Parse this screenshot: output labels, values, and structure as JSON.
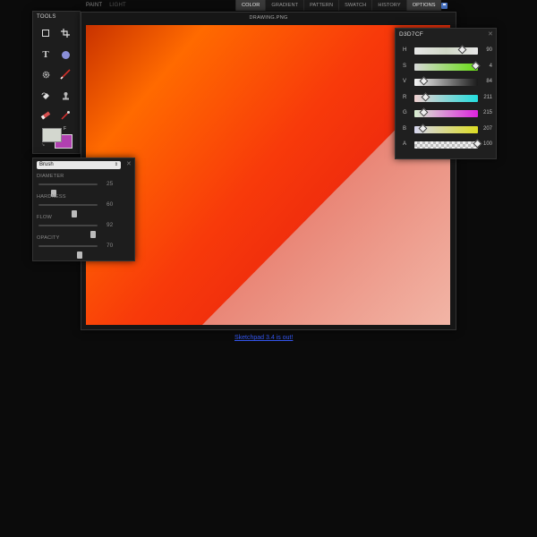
{
  "menu": {
    "left": [
      "PAINT",
      "LIGHT"
    ],
    "tabs": [
      "COLOR",
      "GRADIENT",
      "PATTERN",
      "SWATCH",
      "HISTORY",
      "OPTIONS"
    ],
    "active_tab": "COLOR"
  },
  "tools": {
    "title": "TOOLS",
    "items": [
      {
        "name": "select-tool",
        "glyph": "□"
      },
      {
        "name": "crop-tool",
        "glyph": "⌗"
      },
      {
        "name": "text-tool",
        "glyph": "T"
      },
      {
        "name": "shape-tool",
        "glyph": "●"
      },
      {
        "name": "gear-tool",
        "glyph": "✲"
      },
      {
        "name": "brush-tool",
        "glyph": "╱"
      },
      {
        "name": "fill-tool",
        "glyph": "◭"
      },
      {
        "name": "stamp-tool",
        "glyph": "♟"
      },
      {
        "name": "eraser-tool",
        "glyph": "▬"
      },
      {
        "name": "eyedropper-tool",
        "glyph": "∕"
      }
    ],
    "foreground_color": "#D3D7CF",
    "background_color": "#B040B0",
    "swap_label": "F"
  },
  "drawing": {
    "title": "DRAWING.PNG"
  },
  "color_picker": {
    "hex": "D3D7CF",
    "rows": [
      {
        "label": "H",
        "value": "90",
        "pos": 0.75
      },
      {
        "label": "S",
        "value": "4",
        "pos": 0.96
      },
      {
        "label": "V",
        "value": "84",
        "pos": 0.14
      },
      {
        "label": "R",
        "value": "211",
        "pos": 0.17
      },
      {
        "label": "G",
        "value": "215",
        "pos": 0.14
      },
      {
        "label": "B",
        "value": "207",
        "pos": 0.13
      },
      {
        "label": "A",
        "value": "100",
        "pos": 0.99
      }
    ]
  },
  "brush": {
    "selected": "Brush",
    "params": [
      {
        "label": "DIAMETER",
        "value": "25",
        "pos": 0.25
      },
      {
        "label": "HARDNESS",
        "value": "60",
        "pos": 0.6
      },
      {
        "label": "FLOW",
        "value": "92",
        "pos": 0.92
      },
      {
        "label": "OPACITY",
        "value": "70",
        "pos": 0.7
      }
    ]
  },
  "footer_link": "Sketchpad 3.4 is out!",
  "colors": {
    "accent": "#3a3a3a",
    "link": "#3355ee"
  }
}
